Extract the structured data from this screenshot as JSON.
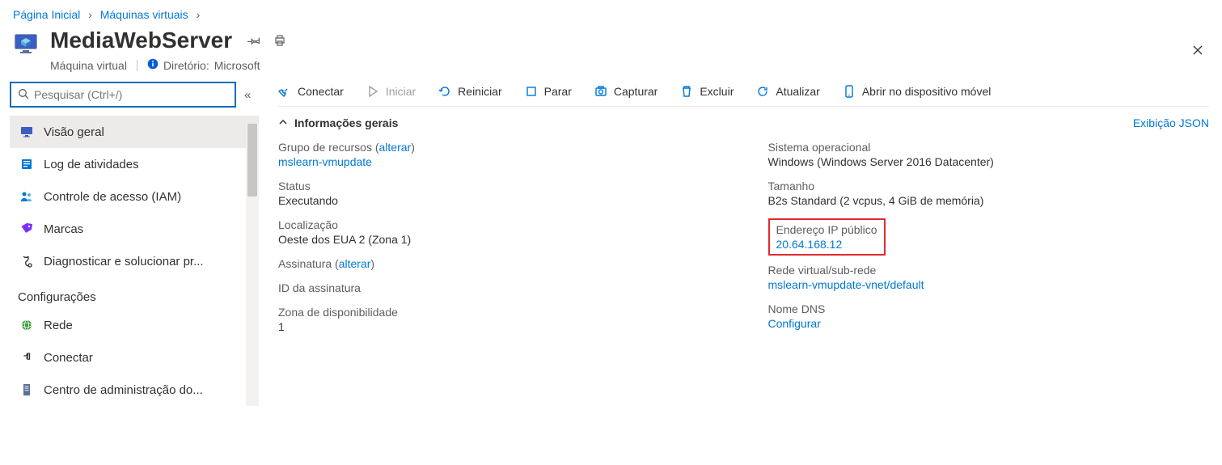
{
  "breadcrumb": {
    "home": "Página Inicial",
    "vms": "Máquinas virtuais"
  },
  "header": {
    "title": "MediaWebServer",
    "subtitle": "Máquina virtual",
    "directory_label": "Diretório:",
    "directory_value": "Microsoft"
  },
  "sidebar": {
    "search_placeholder": "Pesquisar (Ctrl+/)",
    "items": [
      {
        "label": "Visão geral"
      },
      {
        "label": "Log de atividades"
      },
      {
        "label": "Controle de acesso (IAM)"
      },
      {
        "label": "Marcas"
      },
      {
        "label": "Diagnosticar e solucionar pr..."
      }
    ],
    "section_label": "Configurações",
    "settings_items": [
      {
        "label": "Rede"
      },
      {
        "label": "Conectar"
      },
      {
        "label": "Centro de administração do..."
      }
    ]
  },
  "toolbar": {
    "connect": "Conectar",
    "start": "Iniciar",
    "restart": "Reiniciar",
    "stop": "Parar",
    "capture": "Capturar",
    "delete": "Excluir",
    "refresh": "Atualizar",
    "open_mobile": "Abrir no dispositivo móvel"
  },
  "essentials": {
    "title": "Informações gerais",
    "json_view": "Exibição JSON",
    "change": "alterar",
    "left": {
      "resource_group_label": "Grupo de recursos",
      "resource_group_value": "mslearn-vmupdate",
      "status_label": "Status",
      "status_value": "Executando",
      "location_label": "Localização",
      "location_value": "Oeste dos EUA 2 (Zona 1)",
      "subscription_label": "Assinatura",
      "subscription_id_label": "ID da assinatura",
      "zone_label": "Zona de disponibilidade",
      "zone_value": "1"
    },
    "right": {
      "os_label": "Sistema operacional",
      "os_value": "Windows (Windows Server 2016 Datacenter)",
      "size_label": "Tamanho",
      "size_value": "B2s Standard (2 vcpus, 4 GiB de memória)",
      "public_ip_label": "Endereço IP público",
      "public_ip_value": "20.64.168.12",
      "vnet_label": "Rede virtual/sub-rede",
      "vnet_value": "mslearn-vmupdate-vnet/default",
      "dns_label": "Nome DNS",
      "dns_value": "Configurar"
    }
  }
}
